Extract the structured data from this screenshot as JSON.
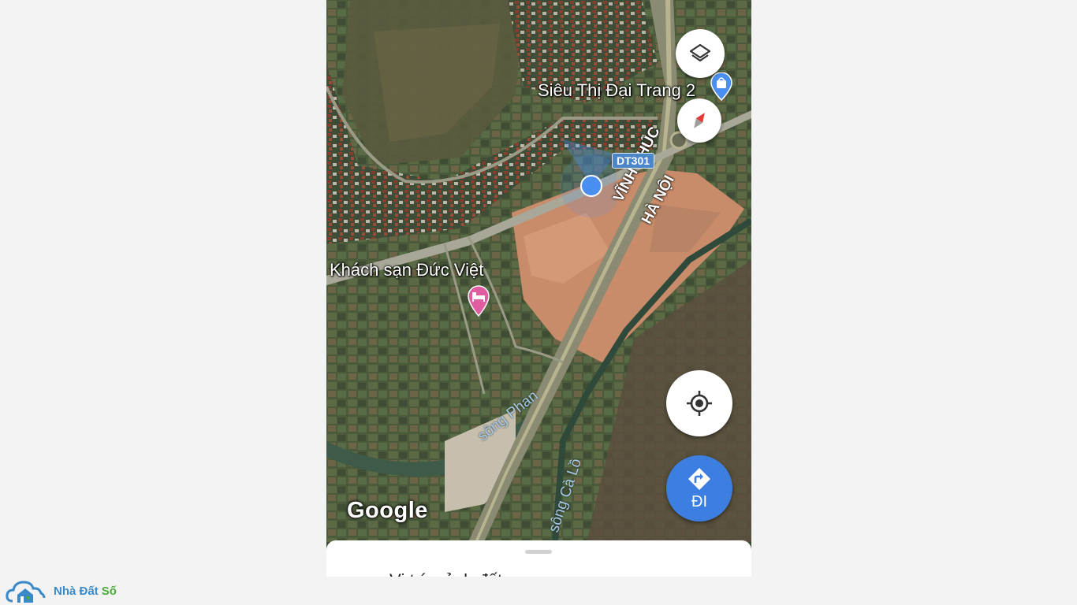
{
  "map": {
    "poi_supermarket": "Siêu Thị Đại Trang 2",
    "poi_hotel": "Khách sạn Đức Việt",
    "road_shield": "DT301",
    "road_label_1": "VĨNH PHÚC",
    "road_label_2": "HÀ NỘI",
    "river_1": "sông Phan",
    "river_2": "sông Cà Lồ",
    "attribution": "Google"
  },
  "controls": {
    "layers_icon": "layers-icon",
    "compass_icon": "compass-icon",
    "location_icon": "my-location-icon",
    "directions_icon": "directions-icon",
    "directions_label": "ĐI"
  },
  "sheet": {
    "title": "Vị trí mảnh đất"
  },
  "logo": {
    "brand_part1": "Nhà Đất",
    "brand_part2": "Số"
  },
  "colors": {
    "accent": "#3d7fe0",
    "location_dot": "#4a8ff0",
    "hotel_pin": "#e05ca0",
    "shop_pin": "#4a8ff0",
    "road_shield": "#4a86c8"
  }
}
